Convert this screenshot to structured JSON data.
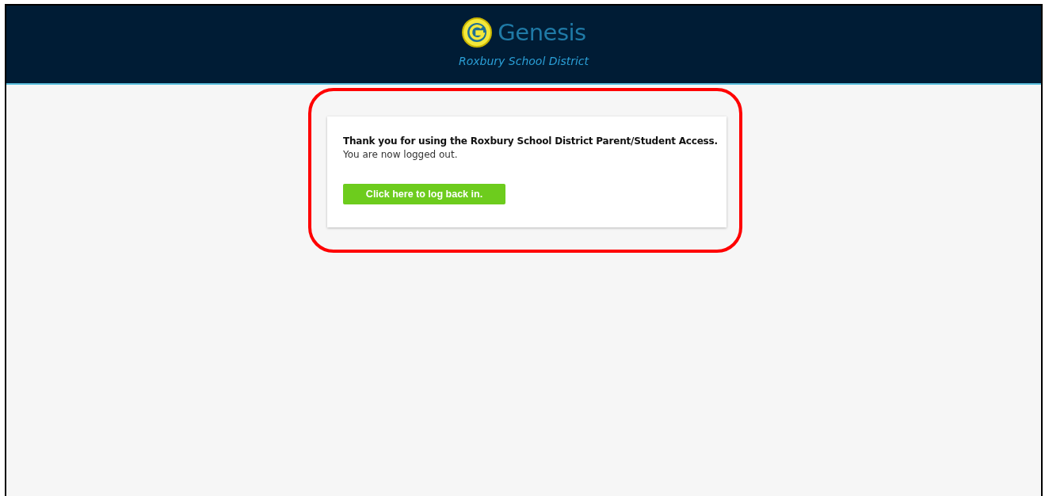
{
  "header": {
    "logo_text": "Genesis",
    "district": "Roxbury School District"
  },
  "message": {
    "title": "Thank you for using the Roxbury School District Parent/Student Access.",
    "subtitle": "You are now logged out.",
    "button": "Click here to log back in."
  },
  "annotation": {
    "highlighted": true
  }
}
